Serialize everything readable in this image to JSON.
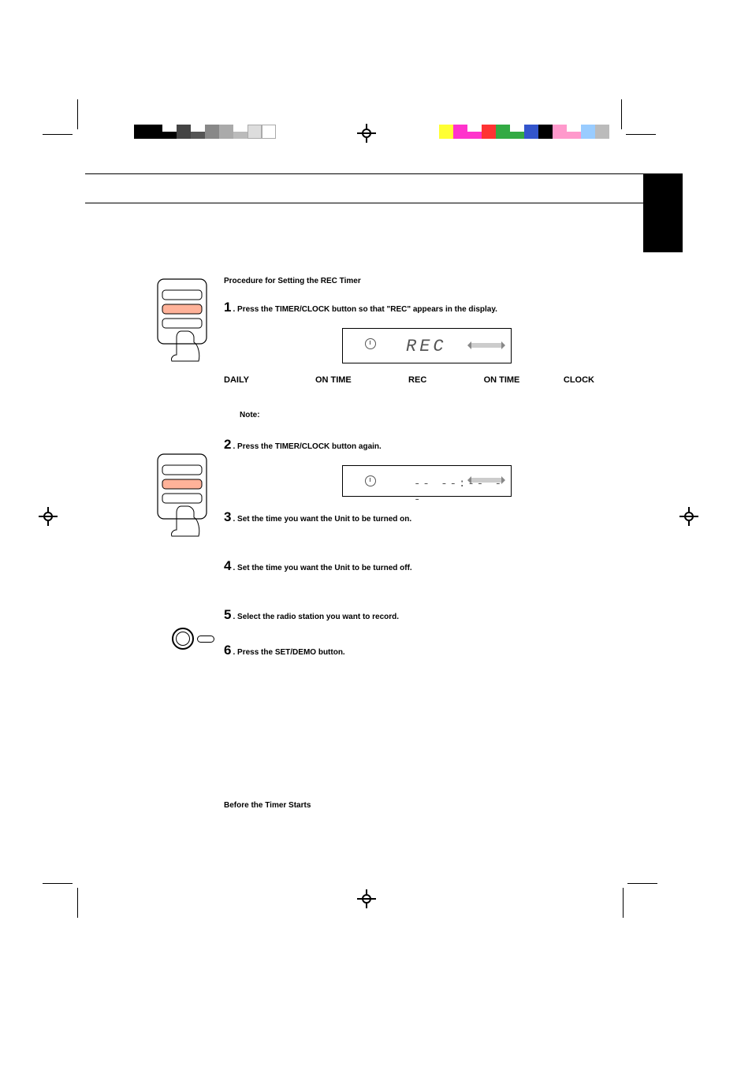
{
  "section_title": "Procedure for Setting the REC Timer",
  "steps": {
    "s1": {
      "num": "1",
      "dot": ".",
      "text": "Press the TIMER/CLOCK button so that \"REC\" appears in the display."
    },
    "s2": {
      "num": "2",
      "dot": ".",
      "text": "Press the TIMER/CLOCK button again."
    },
    "s3": {
      "num": "3",
      "dot": ".",
      "text": "Set the time you want the Unit to be turned on."
    },
    "s4": {
      "num": "4",
      "dot": ".",
      "text": "Set the time you want the Unit to be turned off."
    },
    "s5": {
      "num": "5",
      "dot": ".",
      "text": "Select the radio station you want to record."
    },
    "s6": {
      "num": "6",
      "dot": ".",
      "text": "Press the SET/DEMO button."
    }
  },
  "labels": {
    "daily": "DAILY",
    "on_time1": "ON TIME",
    "rec": "REC",
    "on_time2": "ON TIME",
    "clock": "CLOCK"
  },
  "display1": {
    "text": "REC"
  },
  "display2": {
    "dash": "-- --:-- --"
  },
  "note_label": "Note:",
  "before_timer": "Before the Timer Starts",
  "colors": {
    "black": "#000000",
    "dgray": "#555555",
    "gray": "#999999",
    "lgray": "#cccccc",
    "yellow": "#ffff33",
    "magenta": "#ff33cc",
    "red": "#ff3333",
    "green": "#33aa44",
    "blue": "#3355cc",
    "dblue": "#112288",
    "pink": "#ff99cc",
    "lblue": "#99ccff"
  }
}
